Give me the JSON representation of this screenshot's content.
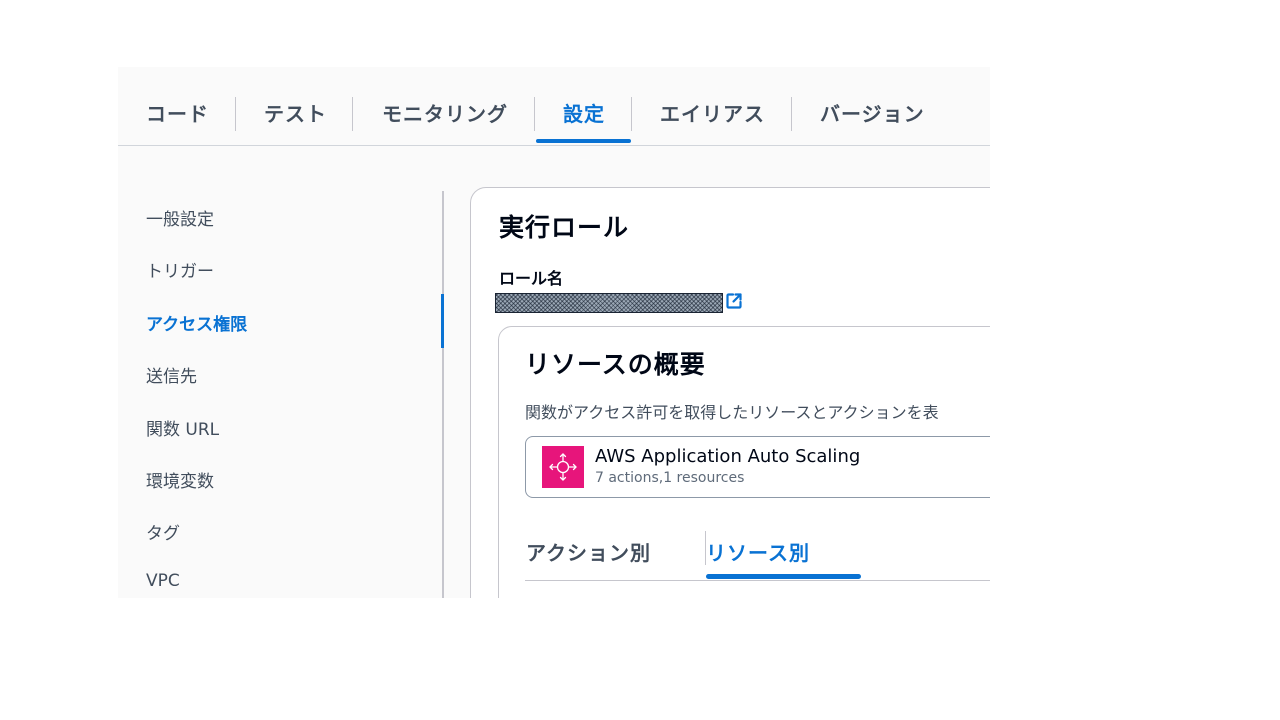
{
  "top_tabs": [
    "コード",
    "テスト",
    "モニタリング",
    "設定",
    "エイリアス",
    "バージョン"
  ],
  "top_tab_active": "設定",
  "nav": {
    "items": [
      "一般設定",
      "トリガー",
      "アクセス権限",
      "送信先",
      "関数 URL",
      "環境変数",
      "タグ",
      "VPC"
    ],
    "active": "アクセス権限"
  },
  "role": {
    "title": "実行ロール",
    "name_label": "ロール名",
    "name_value": "",
    "link_icon": "external-link-icon"
  },
  "summary": {
    "title": "リソースの概要",
    "description": "関数がアクセス許可を取得したリソースとアクションを表",
    "service": {
      "name": "AWS Application Auto Scaling",
      "stats": "7 actions,1 resources",
      "icon": "application-auto-scaling-icon",
      "icon_color": "#e7157b"
    },
    "tabs": [
      "アクション別",
      "リソース別"
    ],
    "active_tab": "リソース別"
  },
  "colors": {
    "accent": "#0972d3",
    "text": "#16191f",
    "muted": "#414d5c",
    "border": "#c6c6cd"
  }
}
